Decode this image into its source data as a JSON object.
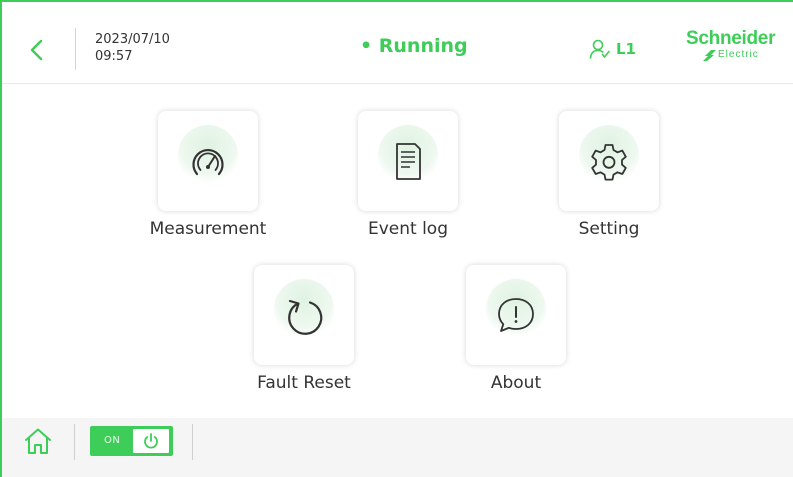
{
  "header": {
    "date": "2023/07/10",
    "time": "09:57",
    "status": "• Running",
    "user_level": "L1",
    "logo_main": "Schneider",
    "logo_sub": "Electric"
  },
  "menu": {
    "tiles": [
      {
        "label": "Measurement",
        "icon": "gauge-icon"
      },
      {
        "label": "Event log",
        "icon": "document-icon"
      },
      {
        "label": "Setting",
        "icon": "gear-icon"
      },
      {
        "label": "Fault Reset",
        "icon": "reset-icon"
      },
      {
        "label": "About",
        "icon": "info-bubble-icon"
      }
    ]
  },
  "footer": {
    "toggle_label": "ON",
    "home_icon": "home-icon",
    "power_icon": "power-icon"
  },
  "colors": {
    "accent": "#3dcd58",
    "text": "#333333",
    "footer_bg": "#f5f5f5"
  }
}
